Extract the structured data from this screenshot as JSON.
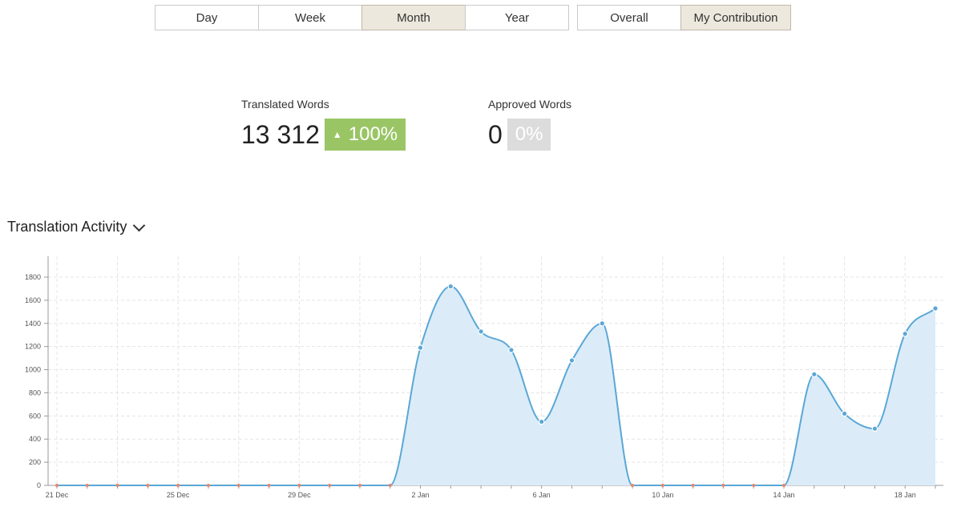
{
  "period_tabs": [
    {
      "label": "Day",
      "active": false
    },
    {
      "label": "Week",
      "active": false
    },
    {
      "label": "Month",
      "active": true
    },
    {
      "label": "Year",
      "active": false
    }
  ],
  "scope_tabs": [
    {
      "label": "Overall",
      "active": false
    },
    {
      "label": "My Contribution",
      "active": true
    }
  ],
  "stats": {
    "translated": {
      "label": "Translated Words",
      "value": "13 312",
      "change": "100%",
      "trend_icon": "triangle-up-icon",
      "color": "#9ac565"
    },
    "approved": {
      "label": "Approved Words",
      "value": "0",
      "change": "0%",
      "color": "#dcdcdc"
    }
  },
  "section": {
    "title": "Translation Activity",
    "icon": "chevron-down-icon"
  },
  "colors": {
    "line": "#5aa7d6",
    "fill": "#dbecf8",
    "zero_marker": "#e8866a",
    "active_tab": "#ece8dd"
  },
  "chart_data": {
    "type": "area",
    "title": "Translation Activity",
    "xlabel": "",
    "ylabel": "",
    "ylim": [
      0,
      1800
    ],
    "yticks": [
      0,
      200,
      400,
      600,
      800,
      1000,
      1200,
      1400,
      1600,
      1800
    ],
    "grid": true,
    "legend": "none",
    "x": [
      "21 Dec",
      "22 Dec",
      "23 Dec",
      "24 Dec",
      "25 Dec",
      "26 Dec",
      "27 Dec",
      "28 Dec",
      "29 Dec",
      "30 Dec",
      "31 Dec",
      "1 Jan",
      "2 Jan",
      "3 Jan",
      "4 Jan",
      "5 Jan",
      "6 Jan",
      "7 Jan",
      "8 Jan",
      "9 Jan",
      "10 Jan",
      "11 Jan",
      "12 Jan",
      "13 Jan",
      "14 Jan",
      "15 Jan",
      "16 Jan",
      "17 Jan",
      "18 Jan",
      "19 Jan"
    ],
    "xtick_labels": [
      {
        "index": 0,
        "label": "21 Dec"
      },
      {
        "index": 4,
        "label": "25 Dec"
      },
      {
        "index": 8,
        "label": "29 Dec"
      },
      {
        "index": 12,
        "label": "2 Jan"
      },
      {
        "index": 16,
        "label": "6 Jan"
      },
      {
        "index": 20,
        "label": "10 Jan"
      },
      {
        "index": 24,
        "label": "14 Jan"
      },
      {
        "index": 28,
        "label": "18 Jan"
      }
    ],
    "series": [
      {
        "values": [
          0,
          0,
          0,
          0,
          0,
          0,
          0,
          0,
          0,
          0,
          0,
          0,
          1190,
          1720,
          1330,
          1170,
          550,
          1080,
          1400,
          0,
          0,
          0,
          0,
          0,
          0,
          960,
          620,
          490,
          1310,
          1530
        ]
      }
    ]
  }
}
